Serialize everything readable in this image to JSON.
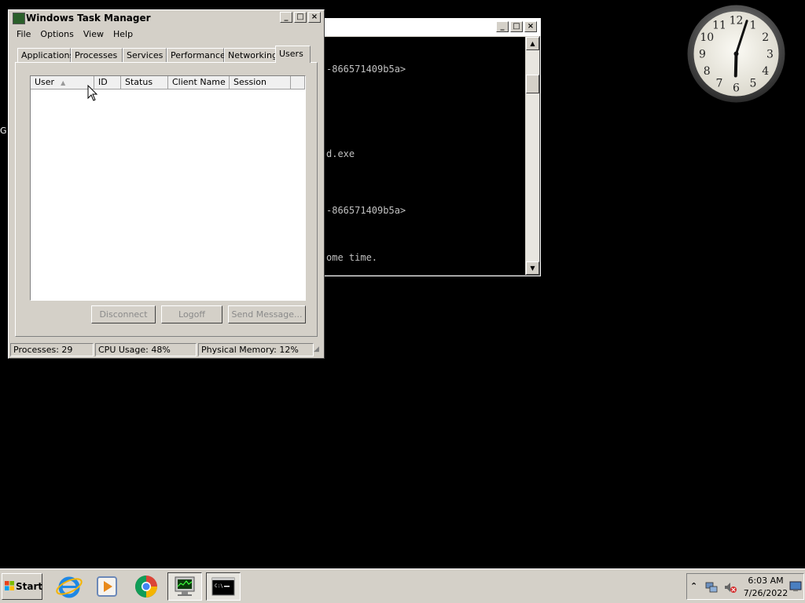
{
  "console": {
    "lines": [
      "-866571409b5a>",
      "d.exe",
      "-866571409b5a>",
      "ome time."
    ]
  },
  "desktop": {
    "edge_text": "G"
  },
  "taskmanager": {
    "title": "Windows Task Manager",
    "menu": [
      "File",
      "Options",
      "View",
      "Help"
    ],
    "tabs": [
      "Applications",
      "Processes",
      "Services",
      "Performance",
      "Networking",
      "Users"
    ],
    "active_tab": "Users",
    "columns": [
      "User",
      "ID",
      "Status",
      "Client Name",
      "Session"
    ],
    "buttons": {
      "disconnect": "Disconnect",
      "logoff": "Logoff",
      "send_message": "Send Message..."
    },
    "status": {
      "processes": "Processes: 29",
      "cpu": "CPU Usage: 48%",
      "memory": "Physical Memory: 12%"
    }
  },
  "clock": {
    "hour": 6,
    "minute": 3,
    "numerals": [
      "12",
      "1",
      "2",
      "3",
      "4",
      "5",
      "6",
      "7",
      "8",
      "9",
      "10",
      "11"
    ]
  },
  "taskbar": {
    "start_label": "Start",
    "apps": [
      "internet-explorer-icon",
      "media-player-icon",
      "chrome-icon",
      "task-manager-icon",
      "command-prompt-icon"
    ],
    "time": "6:03 AM",
    "date": "7/26/2022"
  }
}
